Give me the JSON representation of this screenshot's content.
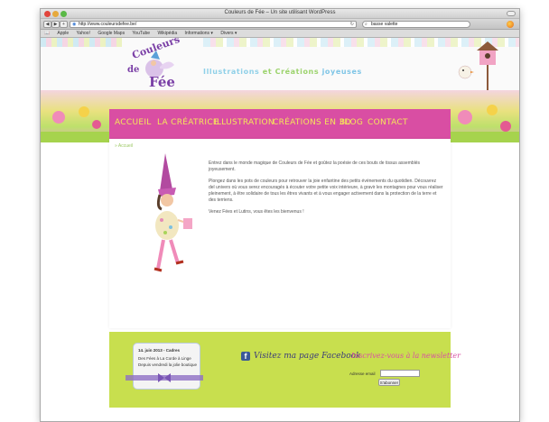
{
  "window": {
    "title": "Couleurs de Fée – Un site utilisant WordPress"
  },
  "toolbar": {
    "url": "http://www.couleursdefee.be/",
    "search_value": "basse valette"
  },
  "bookmarks": [
    "Apple",
    "Yahoo!",
    "Google Maps",
    "YouTube",
    "Wikipédia",
    "Informations ▾",
    "Divers ▾"
  ],
  "header": {
    "logo_line1": "Couleurs",
    "logo_line2": "de",
    "logo_line3": "Fée",
    "tagline_part1": "Illustrations ",
    "tagline_part2": "et ",
    "tagline_part3": "Créations ",
    "tagline_part4": "joyeuses"
  },
  "menu": {
    "items": [
      "ACCUEIL",
      "LA CRÉATRICE",
      "ILLUSTRATION",
      "CRÉATIONS EN 3D",
      "BLOG",
      "CONTACT"
    ]
  },
  "content": {
    "breadcrumb": "» Accueil",
    "paragraph1": "Entrez dans le monde magique de Couleurs de Fée et goûtez la poésie de ces bouts de tissus assemblés joyeusement.",
    "paragraph2": "Plongez dans les pots de couleurs pour retrouver la joie enfantine des petits évènements du quotidien. Découvrez del univers où vous serez encouragés à écouter votre petite voix intérieure, à gravir les montagnes pour vous réaliser pleinement, à être solidaire de tous les êtres vivants et à vous engager activement dans la protection de la terre et des terriens.",
    "paragraph3": "Venez Fées et Lutins, vous êtes les bienvenus !"
  },
  "footer": {
    "news_date": "14. juin 2013 - Cadres",
    "news_line1": "Des Fées à La Corde à Linge",
    "news_line2": "Depuis vendredi la jolie boutique",
    "facebook_text": "Visitez ma page Facebook",
    "newsletter_title": "Inscrivez-vous à la newsletter",
    "newsletter_label": "Adresse email",
    "newsletter_button": "S'abonner"
  },
  "colors": {
    "menu_bg": "#d94ea3",
    "menu_text": "#f5e65a",
    "footer_bg": "#c8df4e",
    "logo": "#7a3fa6"
  }
}
